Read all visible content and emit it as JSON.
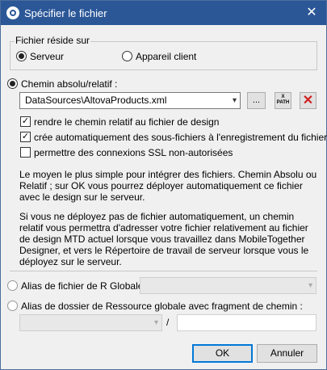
{
  "window": {
    "title": "Spécifier le fichier",
    "close_glyph": "✕"
  },
  "location_group": {
    "legend": "Fichier réside sur",
    "options": [
      {
        "label": "Serveur",
        "selected": true
      },
      {
        "label": "Appareil client",
        "selected": false
      }
    ]
  },
  "absolute_path": {
    "label": "Chemin absolu/relatif :",
    "selected": true,
    "value": "DataSources\\AltovaProducts.xml",
    "browse_label": "...",
    "xpath_label": "X\nPATH",
    "delete_icon": "delete-icon"
  },
  "checkboxes": [
    {
      "label": "rendre le chemin relatif au fichier de design",
      "checked": true
    },
    {
      "label": "crée automatiquement des sous-fichiers à l'enregistrement du fichier",
      "checked": true
    },
    {
      "label": "permettre des connexions SSL non-autorisées",
      "checked": false
    }
  ],
  "info": [
    "Le moyen le plus simple pour intégrer des fichiers. Chemin Absolu ou Relatif ; sur OK vous pourrez déployer automatiquement ce fichier avec le design sur le serveur.",
    "Si vous ne déployez pas de fichier automatiquement, un chemin relatif vous permettra d'adresser votre fichier relativement au fichier de design MTD actuel lorsque vous travaillez dans MobileTogether Designer, et vers le Répertoire de travail de serveur lorsque vous le déployez sur le serveur."
  ],
  "global_alias": {
    "label": "Alias de fichier de R Globale :",
    "selected": false,
    "value": ""
  },
  "global_folder": {
    "label": "Alias de dossier de Ressource globale avec fragment de chemin :",
    "selected": false,
    "value": "",
    "path_fragment": "",
    "separator": "/"
  },
  "buttons": {
    "ok": "OK",
    "cancel": "Annuler"
  },
  "colors": {
    "titlebar": "#2b5797",
    "accent": "#0078d7",
    "delete": "#d02020"
  }
}
